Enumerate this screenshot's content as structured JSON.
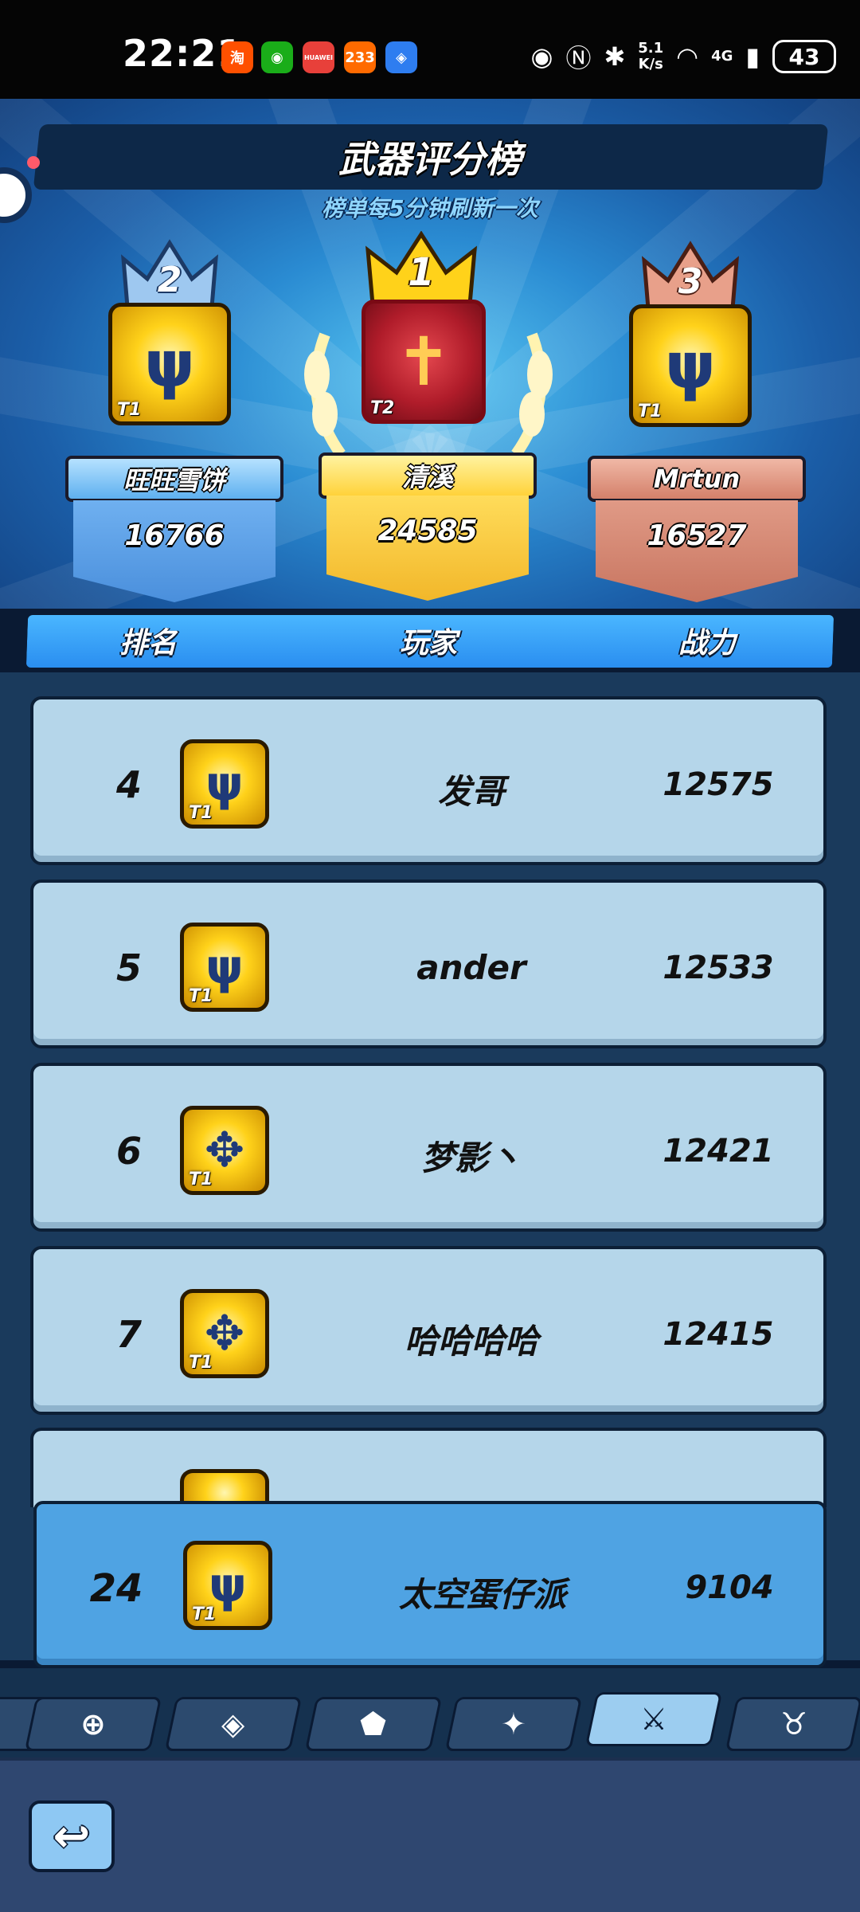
{
  "status_bar": {
    "time": "22:21",
    "apps": [
      {
        "icon": "taobao-icon",
        "glyph": "淘",
        "color": "#ff5000"
      },
      {
        "icon": "wechat-icon",
        "glyph": "◉",
        "color": "#1aad19"
      },
      {
        "icon": "huawei-icon",
        "glyph": "HUAWEI",
        "color": "#e8403a"
      },
      {
        "icon": "app-233-icon",
        "glyph": "233",
        "color": "#ff6a00"
      },
      {
        "icon": "browser-icon",
        "glyph": "◈",
        "color": "#2e7df0"
      }
    ],
    "net_speed": "5.1",
    "net_unit": "K/s",
    "network": "4G",
    "battery": "43"
  },
  "header": {
    "title": "武器评分榜",
    "subtitle": "榜单每5分钟刷新一次"
  },
  "podium": [
    {
      "rank": "2",
      "player": "旺旺雪饼",
      "score": "16766",
      "tier": "T1",
      "icon": "gold-trident-icon"
    },
    {
      "rank": "1",
      "player": "清溪",
      "score": "24585",
      "tier": "T2",
      "icon": "red-cross-staff-icon"
    },
    {
      "rank": "3",
      "player": "Mrtun",
      "score": "16527",
      "tier": "T1",
      "icon": "gold-trident-icon"
    }
  ],
  "table_header": {
    "rank": "排名",
    "player": "玩家",
    "power": "战力"
  },
  "rows": [
    {
      "rank": "4",
      "player": "发哥",
      "power": "12575",
      "tier": "T1"
    },
    {
      "rank": "5",
      "player": "ander",
      "power": "12533",
      "tier": "T1"
    },
    {
      "rank": "6",
      "player": "梦影丶",
      "power": "12421",
      "tier": "T1"
    },
    {
      "rank": "7",
      "player": "哈哈哈哈",
      "power": "12415",
      "tier": "T1"
    }
  ],
  "my_entry": {
    "rank": "24",
    "player": "太空蛋仔派",
    "power": "9104",
    "tier": "T1"
  },
  "tabs": [
    {
      "icon": "target-icon",
      "glyph": "⊕"
    },
    {
      "icon": "shield-icon",
      "glyph": "◈"
    },
    {
      "icon": "armor-icon",
      "glyph": "⬟"
    },
    {
      "icon": "sparkle-icon",
      "glyph": "✦"
    },
    {
      "icon": "weapon-icon",
      "glyph": "⚔"
    },
    {
      "icon": "helmet-icon",
      "glyph": "♉"
    }
  ],
  "back_button": {
    "glyph": "↩"
  }
}
